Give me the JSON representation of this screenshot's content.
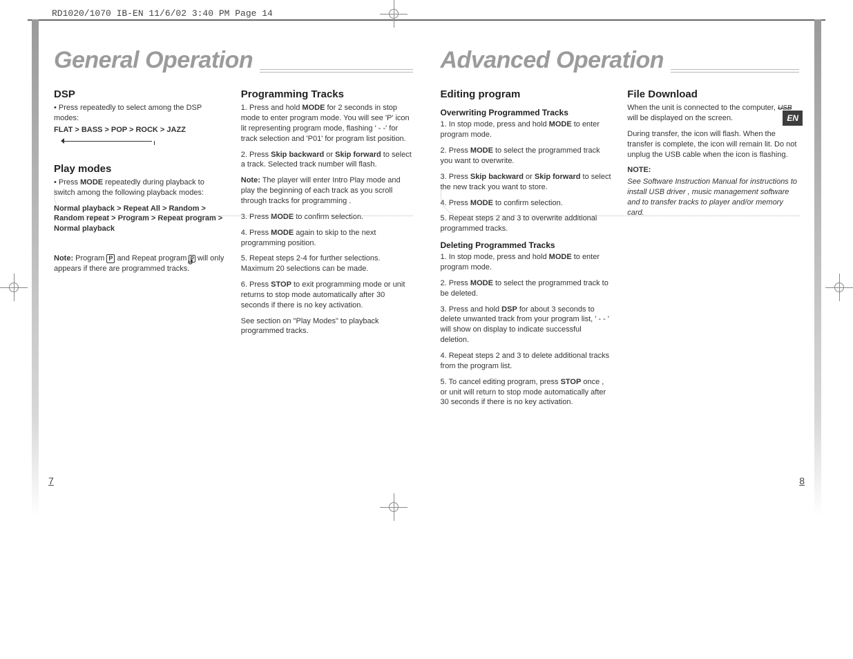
{
  "header": "RD1020/1070 IB-EN  11/6/02  3:40 PM  Page 14",
  "lang_badge": "EN",
  "page_left_num": "7",
  "page_right_num": "8",
  "left": {
    "title": "General Operation",
    "col1": {
      "h_dsp": "DSP",
      "dsp_p1": "• Press repeatedly  to select among the DSP modes:",
      "dsp_modes": "FLAT > BASS > POP > ROCK > JAZZ",
      "h_play": "Play modes",
      "play_p1a": "• Press ",
      "play_mode_b": "MODE",
      "play_p1b": " repeatedly during playback to switch among the following playback modes:",
      "play_chain": "Normal playback > Repeat All > Random > Random repeat > Program > Repeat program > Normal playback",
      "note_lbl": "Note:",
      "note_txt1": "  Program  ",
      "note_icon1": "P",
      "note_txt2": "  and Repeat program  ",
      "note_icon2": "P",
      "note_txt3": "  will only appears if there are programmed tracks."
    },
    "col2": {
      "h_prog": "Programming Tracks",
      "s1a": "1.  Press and hold ",
      "s1_mode": "MODE",
      "s1b": " for 2 seconds in stop mode to enter program mode. You will see 'P' icon lit representing program mode,  flashing ' - -' for track selection and 'P01'  for  program list position.",
      "s2a": "2. Press ",
      "s2_sb": "Skip backward",
      "s2_or": " or ",
      "s2_sf": "Skip forward",
      "s2b": " to select a track. Selected track number will flash.",
      "n2_lbl": "Note:",
      "n2_txt": " The player will enter Intro Play mode and play the beginning of each track as you scroll through tracks for programming .",
      "s3a": "3. Press ",
      "s3_mode": "MODE",
      "s3b": " to confirm selection.",
      "s4a": "4. Press ",
      "s4_mode": "MODE",
      "s4b": " again to skip to the next programming position.",
      "s5": "5. Repeat steps 2-4 for further selections. Maximum 20 selections can be made.",
      "s6a": "6. Press ",
      "s6_stop": "STOP",
      "s6b": " to exit programming mode or unit returns to stop mode automatically after 30 seconds if there is no key activation.",
      "s7": "See section on \"Play Modes\" to playback programmed tracks."
    }
  },
  "right": {
    "title": "Advanced Operation",
    "col1": {
      "h_edit": "Editing program",
      "h_over": "Overwriting Programmed Tracks",
      "o1a": "1.  In stop mode, press and hold ",
      "o1_mode": "MODE",
      "o1b": " to enter program mode.",
      "o2a": "2.  Press ",
      "o2_mode": "MODE",
      "o2b": " to select the programmed track you want to overwrite.",
      "o3a": "3.  Press ",
      "o3_sb": "Skip backward",
      "o3_or": " or ",
      "o3_sf": "Skip forward",
      "o3b": " to select the new track you want to store.",
      "o4a": "4.  Press ",
      "o4_mode": "MODE",
      "o4b": " to confirm selection.",
      "o5": "5.  Repeat steps 2 and 3 to overwrite additional programmed tracks.",
      "h_del": "Deleting Programmed Tracks",
      "d1a": "1. In stop mode, press and hold ",
      "d1_mode": "MODE",
      "d1b": " to enter program mode.",
      "d2a": "2.  Press ",
      "d2_mode": "MODE",
      "d2b": " to select the programmed track to be deleted.",
      "d3a": "3. Press and hold ",
      "d3_dsp": "DSP",
      "d3b": " for about 3 seconds  to delete unwanted track from your program list,  ' - - ' will show on display to indicate successful deletion.",
      "d4": "4.  Repeat steps 2 and 3 to delete additional tracks from the program list.",
      "d5a": " 5.  To cancel editing program, press ",
      "d5_stop": "STOP",
      "d5b": " once , or unit will return to stop mode automatically after 30 seconds if there is no key activation."
    },
    "col2": {
      "h_file": "File Download",
      "f1a": "When the unit is connected to the computer,  ",
      "f1_usb": "USB",
      "f1b": "  will be displayed on the screen.",
      "f2": "During transfer, the icon will flash. When the transfer is complete, the icon will remain lit. Do not unplug the USB cable when the icon is flashing.",
      "n_lbl": "NOTE:",
      "n_txt": "See Software Instruction Manual for instructions to install USB driver , music management software and to transfer tracks to player and/or memory card."
    }
  }
}
